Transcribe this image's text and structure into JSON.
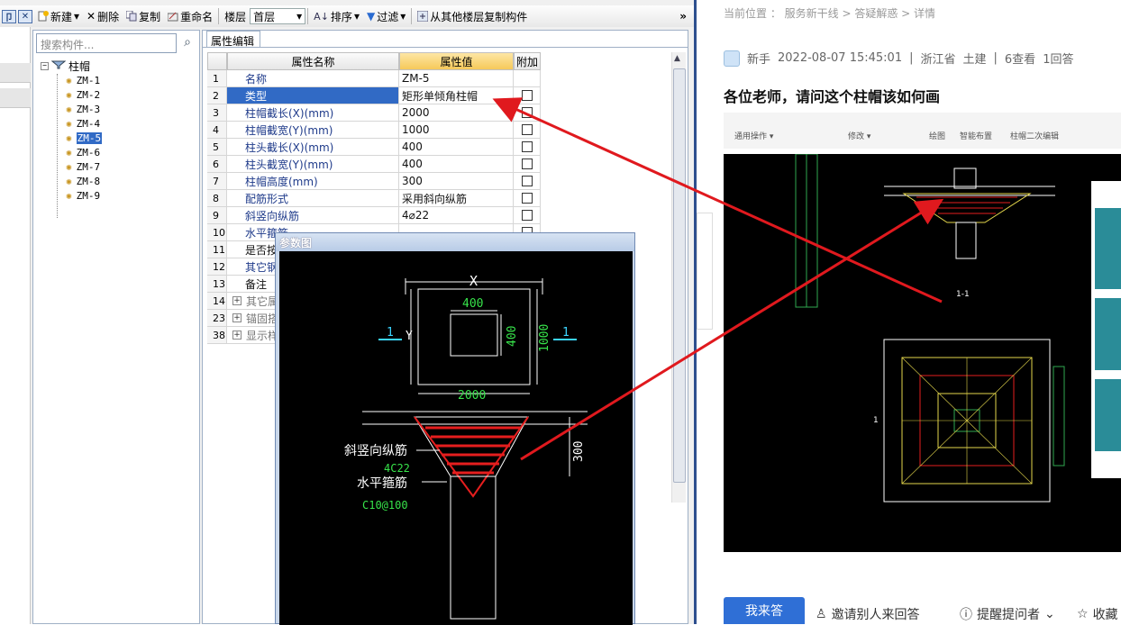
{
  "toolbar": {
    "new_label": "新建",
    "delete_label": "删除",
    "copy_label": "复制",
    "rename_label": "重命名",
    "floor_label": "楼层",
    "floor_value": "首层",
    "sort_label": "排序",
    "filter_label": "过滤",
    "copy_from_floor_label": "从其他楼层复制构件",
    "more_label": "»",
    "min_icon": "pin-icon",
    "close_icon": "close-icon"
  },
  "tree": {
    "search_placeholder": "搜索构件...",
    "root_label": "柱帽",
    "root_toggle": "−",
    "items": [
      "ZM-1",
      "ZM-2",
      "ZM-3",
      "ZM-4",
      "ZM-5",
      "ZM-6",
      "ZM-7",
      "ZM-8",
      "ZM-9"
    ],
    "selected": "ZM-5"
  },
  "props": {
    "tab_label": "属性编辑",
    "headers": {
      "name": "属性名称",
      "value": "属性值",
      "extra": "附加"
    },
    "rows": [
      {
        "no": "1",
        "name": "名称",
        "value": "ZM-5",
        "checkbox": false
      },
      {
        "no": "2",
        "name": "类型",
        "value": "矩形单倾角柱帽",
        "checkbox": true
      },
      {
        "no": "3",
        "name": "柱帽截长(X)(mm)",
        "value": "2000",
        "checkbox": true
      },
      {
        "no": "4",
        "name": "柱帽截宽(Y)(mm)",
        "value": "1000",
        "checkbox": true
      },
      {
        "no": "5",
        "name": "柱头截长(X)(mm)",
        "value": "400",
        "checkbox": true
      },
      {
        "no": "6",
        "name": "柱头截宽(Y)(mm)",
        "value": "400",
        "checkbox": true
      },
      {
        "no": "7",
        "name": "柱帽高度(mm)",
        "value": "300",
        "checkbox": true
      },
      {
        "no": "8",
        "name": "配筋形式",
        "value": "采用斜向纵筋",
        "checkbox": true
      },
      {
        "no": "9",
        "name": "斜竖向纵筋",
        "value": "4⌀22",
        "checkbox": true
      },
      {
        "no": "10",
        "name": "水平箍筋",
        "value": "",
        "checkbox": true
      },
      {
        "no": "11",
        "name": "是否按",
        "value": "",
        "checkbox": false
      },
      {
        "no": "12",
        "name": "其它钢",
        "value": "",
        "checkbox": false
      },
      {
        "no": "13",
        "name": "备注",
        "value": "",
        "checkbox": false
      },
      {
        "no": "14",
        "name": "其它属",
        "value": "",
        "checkbox": false
      },
      {
        "no": "23",
        "name": "锚固搭",
        "value": "",
        "checkbox": false
      },
      {
        "no": "38",
        "name": "显示样",
        "value": "",
        "checkbox": false
      }
    ],
    "group_toggle": "+"
  },
  "param_dialog": {
    "title": "参数图",
    "x_label": "X",
    "y_label": "Y",
    "head_x": "400",
    "head_y": "400",
    "cap_y": "1000",
    "cap_x": "2000",
    "section_mark": "1",
    "height": "300",
    "rebar_label": "斜竖向纵筋",
    "rebar_value": "4C22",
    "stirrup_label": "水平箍筋",
    "stirrup_value": "C10@100"
  },
  "question": {
    "breadcrumb": "当前位置 ： 服务新干线 > 答疑解惑 > 详情",
    "user_level": "新手",
    "datetime": "2022-08-07 15:45:01",
    "region": "浙江省",
    "category": "土建",
    "views": "6查看",
    "answers": "1回答",
    "title": "各位老师，请问这个柱帽该如何画",
    "shot_labels": [
      "通用操作 ▾",
      "修改 ▾",
      "绘图",
      "智能布置",
      "柱帽二次编辑"
    ],
    "shot_section": "1-1",
    "shot_mark": "1",
    "answer_button": "我来答",
    "invite_label": "邀请别人来回答",
    "remind_label": "提醒提问者",
    "collect_label": "收藏"
  },
  "colors": {
    "selection": "#316ac5",
    "arrow": "#e0191e",
    "accent": "#2f6fd6"
  }
}
